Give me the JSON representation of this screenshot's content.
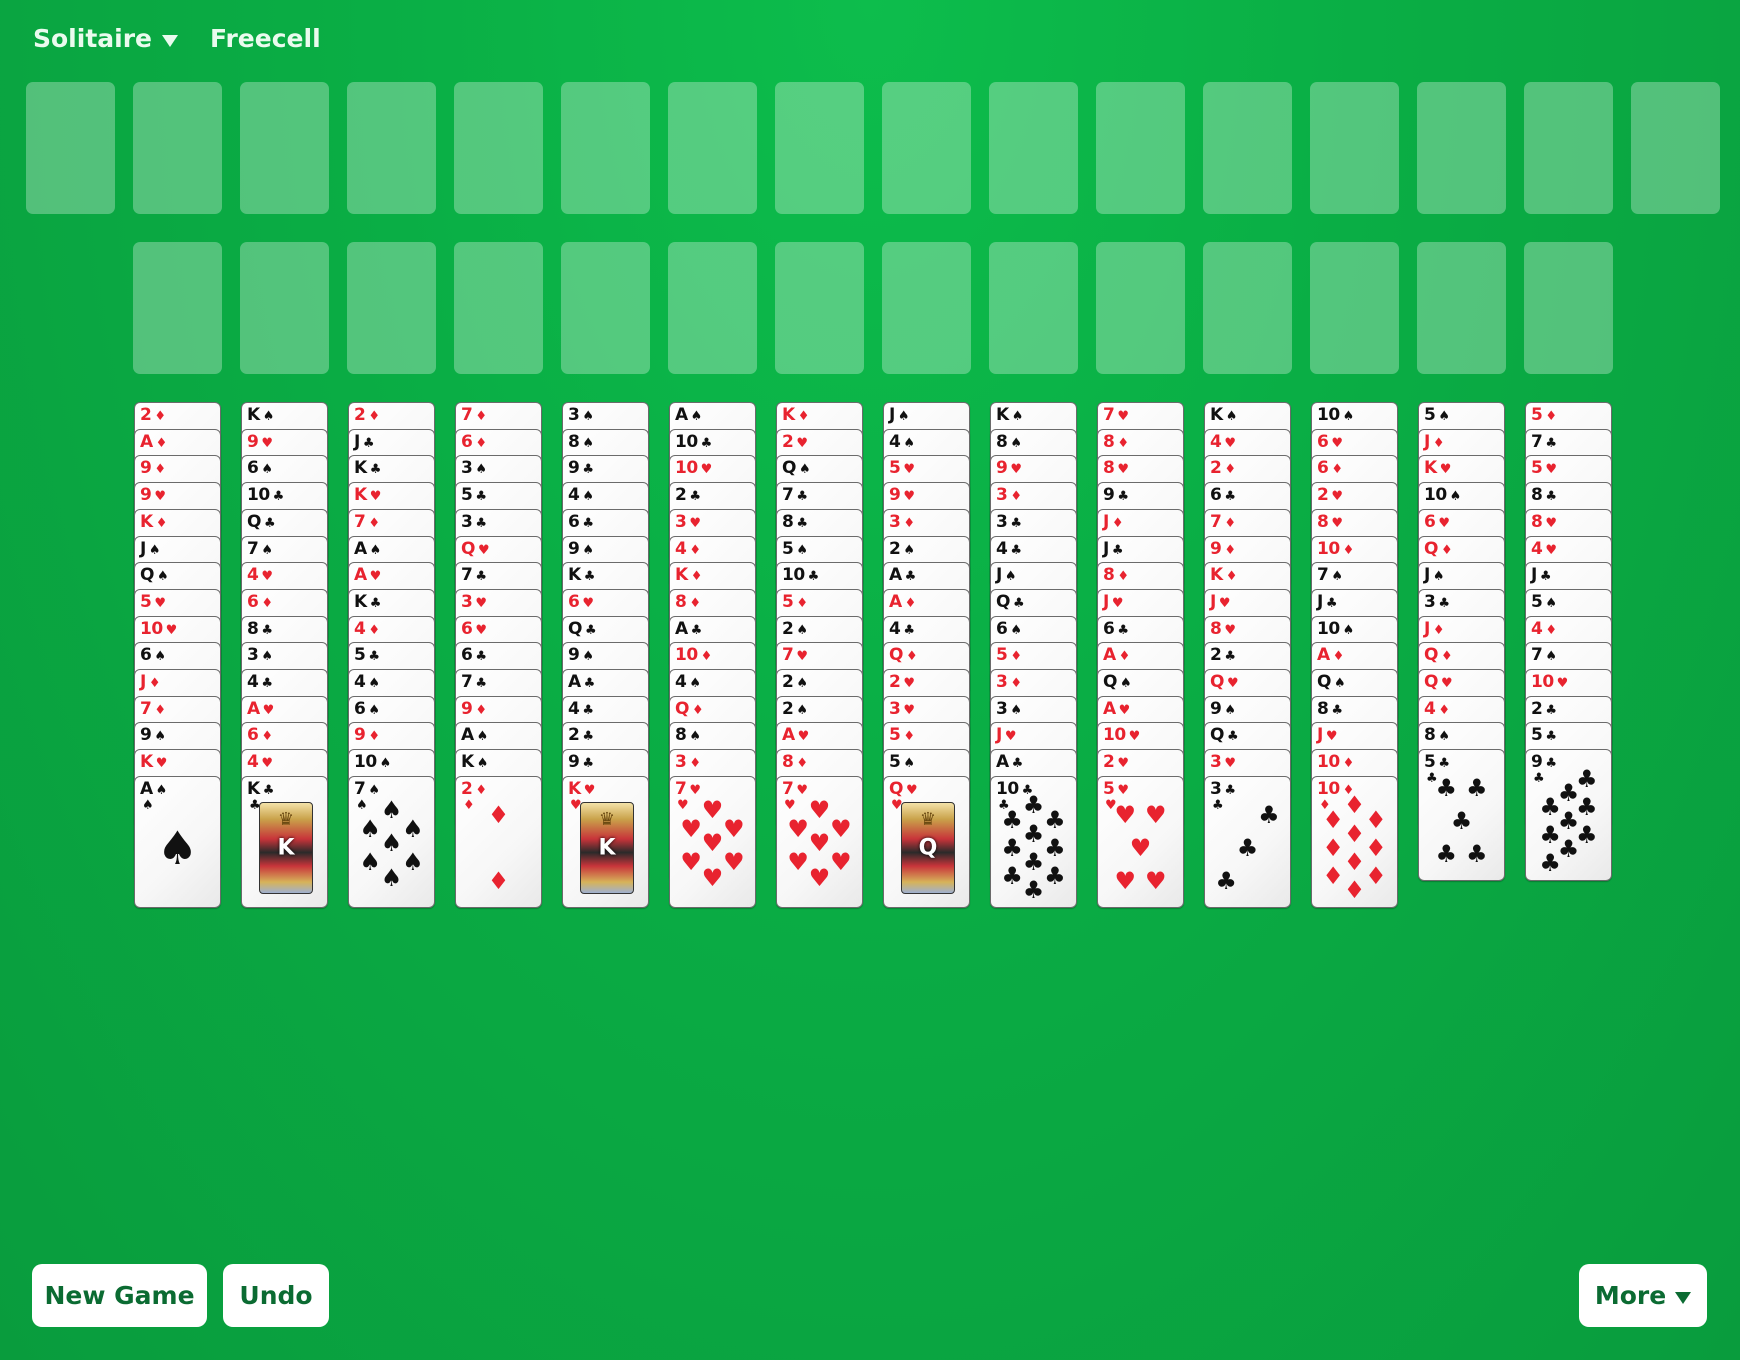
{
  "header": {
    "menu_label": "Solitaire",
    "game_title": "Freecell"
  },
  "footer": {
    "new_game_label": "New Game",
    "undo_label": "Undo",
    "more_label": "More"
  },
  "colors": {
    "background": "#0aae45",
    "button_text": "#0b6b32",
    "red_suit": "#e8232f",
    "black_suit": "#111111"
  },
  "top_row_empty_slots": 16,
  "second_row_empty_slots": 14,
  "tableau": [
    [
      "2♦",
      "A♦",
      "9♦",
      "9♥",
      "K♦",
      "J♠",
      "Q♠",
      "5♥",
      "10♥",
      "6♠",
      "J♦",
      "7♦",
      "9♠",
      "K♥",
      "A♠"
    ],
    [
      "K♠",
      "9♥",
      "6♠",
      "10♣",
      "Q♣",
      "7♠",
      "4♥",
      "6♦",
      "8♣",
      "3♠",
      "4♣",
      "A♥",
      "6♦",
      "4♥",
      "K♣"
    ],
    [
      "2♦",
      "J♣",
      "K♣",
      "K♥",
      "7♦",
      "A♠",
      "A♥",
      "K♣",
      "4♦",
      "5♣",
      "4♠",
      "6♠",
      "9♦",
      "10♠",
      "7♠"
    ],
    [
      "7♦",
      "6♦",
      "3♠",
      "5♣",
      "3♣",
      "Q♥",
      "7♣",
      "3♥",
      "6♥",
      "6♣",
      "7♣",
      "9♦",
      "A♠",
      "K♠",
      "2♦"
    ],
    [
      "3♠",
      "8♠",
      "9♣",
      "4♠",
      "6♣",
      "9♠",
      "K♣",
      "6♥",
      "Q♣",
      "9♠",
      "A♣",
      "4♣",
      "2♣",
      "9♣",
      "K♥"
    ],
    [
      "A♠",
      "10♣",
      "10♥",
      "2♣",
      "3♥",
      "4♦",
      "K♦",
      "8♦",
      "A♣",
      "10♦",
      "4♠",
      "Q♦",
      "8♠",
      "3♦",
      "7♥"
    ],
    [
      "K♦",
      "2♥",
      "Q♠",
      "7♣",
      "8♣",
      "5♠",
      "10♣",
      "5♦",
      "2♠",
      "7♥",
      "2♠",
      "2♠",
      "A♥",
      "8♦",
      "7♥"
    ],
    [
      "J♠",
      "4♠",
      "5♥",
      "9♥",
      "3♦",
      "2♠",
      "A♣",
      "A♦",
      "4♣",
      "Q♦",
      "2♥",
      "3♥",
      "5♦",
      "5♠",
      "Q♥"
    ],
    [
      "K♠",
      "8♠",
      "9♥",
      "3♦",
      "3♣",
      "4♣",
      "J♠",
      "Q♣",
      "6♠",
      "5♦",
      "3♦",
      "3♠",
      "J♥",
      "A♣",
      "10♣"
    ],
    [
      "7♥",
      "8♦",
      "8♥",
      "9♣",
      "J♦",
      "J♣",
      "8♦",
      "J♥",
      "6♣",
      "A♦",
      "Q♠",
      "A♥",
      "10♥",
      "2♥",
      "5♥"
    ],
    [
      "K♠",
      "4♥",
      "2♦",
      "6♣",
      "7♦",
      "9♦",
      "K♦",
      "J♥",
      "8♥",
      "2♣",
      "Q♥",
      "9♠",
      "Q♣",
      "3♥",
      "3♣"
    ],
    [
      "10♠",
      "6♥",
      "6♦",
      "2♥",
      "8♥",
      "10♦",
      "7♠",
      "J♣",
      "10♠",
      "A♦",
      "Q♠",
      "8♣",
      "J♥",
      "10♦",
      "10♦"
    ],
    [
      "5♠",
      "J♦",
      "K♥",
      "10♠",
      "6♥",
      "Q♦",
      "J♠",
      "3♣",
      "J♦",
      "Q♦",
      "Q♥",
      "4♦",
      "8♠",
      "5♣"
    ],
    [
      "5♦",
      "7♣",
      "5♥",
      "8♣",
      "8♥",
      "4♥",
      "J♣",
      "5♠",
      "4♦",
      "7♠",
      "10♥",
      "2♣",
      "5♣",
      "9♣"
    ]
  ]
}
